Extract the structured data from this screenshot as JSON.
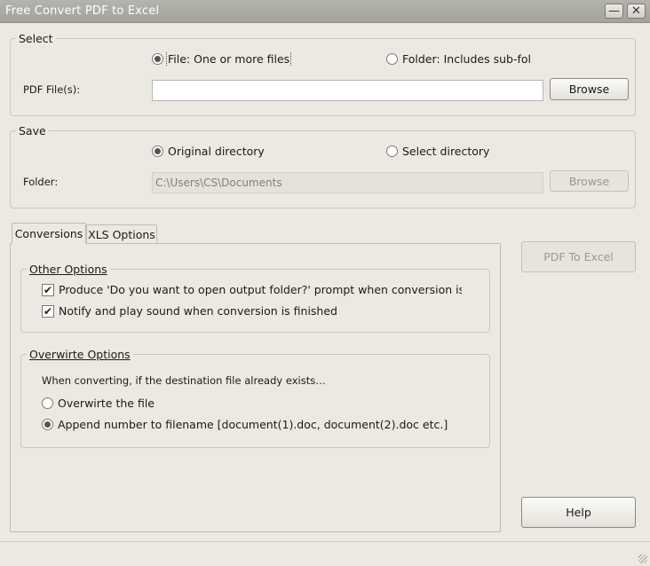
{
  "window": {
    "title": "Free Convert PDF to Excel"
  },
  "select": {
    "legend": "Select",
    "file_radio": "File:  One or more files",
    "folder_radio": "Folder: Includes sub-folders",
    "pdf_label": "PDF File(s):",
    "pdf_value": "",
    "browse": "Browse"
  },
  "save": {
    "legend": "Save",
    "original_radio": "Original directory",
    "select_radio": "Select directory",
    "folder_label": "Folder:",
    "folder_value": "C:\\Users\\CS\\Documents",
    "browse": "Browse"
  },
  "tabs": [
    {
      "label": "Conversions"
    },
    {
      "label": "XLS Options"
    }
  ],
  "other_options": {
    "legend": "Other Options",
    "opt1": "Produce 'Do you want to open output folder?' prompt when conversion is finished",
    "opt2": "Notify and play sound when conversion is finished"
  },
  "overwrite_options": {
    "legend": "Overwirte Options",
    "desc": "When converting, if the destination file already exists…",
    "opt1": "Overwirte the file",
    "opt2": "Append number to filename  [document(1).doc, document(2).doc etc.]"
  },
  "actions": {
    "convert": "PDF To Excel",
    "help": "Help"
  },
  "icons": {
    "minimize": "minimize-icon",
    "close": "close-icon",
    "check": "check-icon"
  }
}
